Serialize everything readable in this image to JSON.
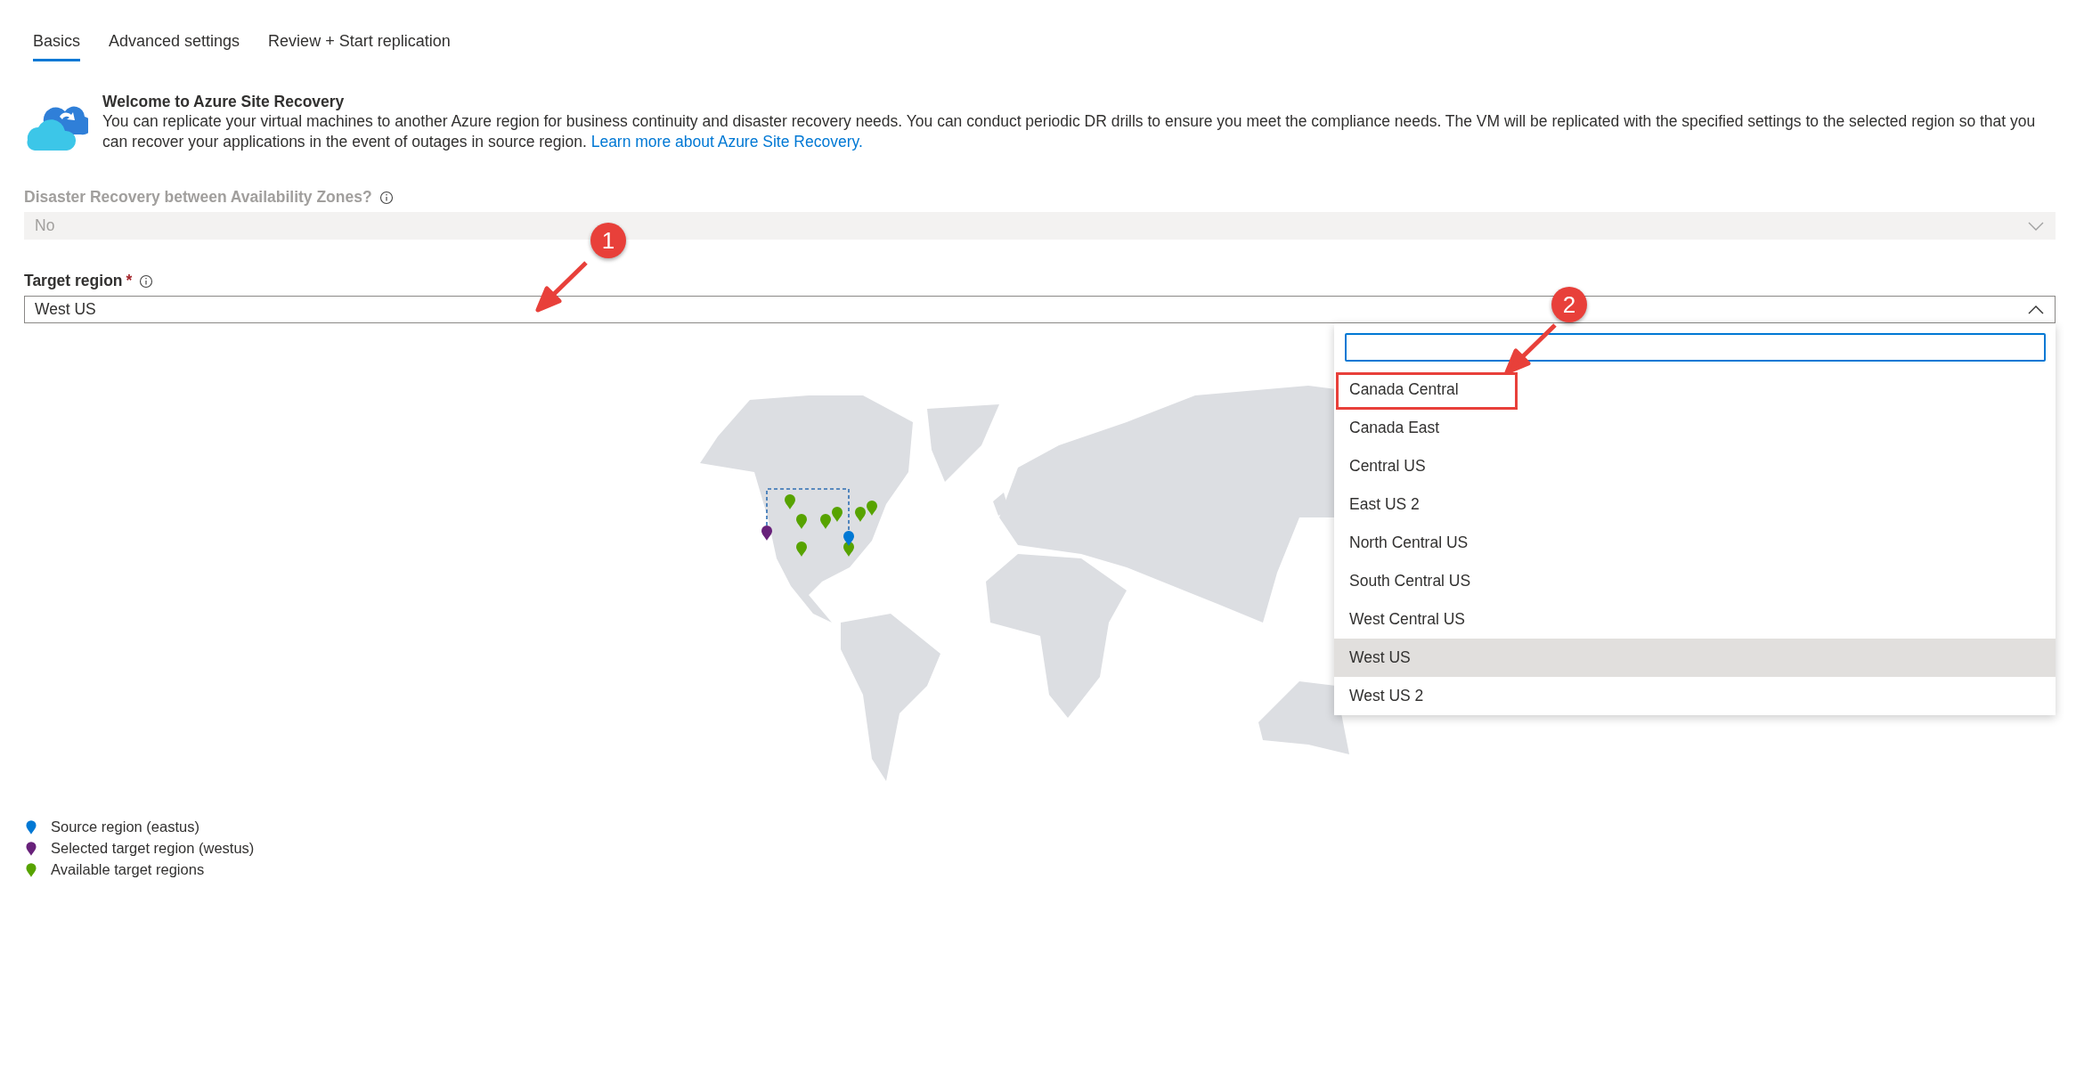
{
  "tabs": [
    {
      "label": "Basics",
      "selected": true
    },
    {
      "label": "Advanced settings",
      "selected": false
    },
    {
      "label": "Review + Start replication",
      "selected": false
    }
  ],
  "intro": {
    "title": "Welcome to Azure Site Recovery",
    "text": "You can replicate your virtual machines to another Azure region for business continuity and disaster recovery needs. You can conduct periodic DR drills to ensure you meet the compliance needs. The VM will be replicated with the specified settings to the selected region so that you can recover your applications in the event of outages in source region.",
    "link": "Learn more about Azure Site Recovery."
  },
  "zone_field": {
    "label": "Disaster Recovery between Availability Zones?",
    "value": "No",
    "disabled": true
  },
  "region_field": {
    "label": "Target region",
    "required_mark": "*",
    "value": "West US",
    "expanded": true,
    "options": [
      {
        "label": "Canada Central",
        "selected": false,
        "highlighted": true
      },
      {
        "label": "Canada East",
        "selected": false,
        "highlighted": false
      },
      {
        "label": "Central US",
        "selected": false,
        "highlighted": false
      },
      {
        "label": "East US 2",
        "selected": false,
        "highlighted": false
      },
      {
        "label": "North Central US",
        "selected": false,
        "highlighted": false
      },
      {
        "label": "South Central US",
        "selected": false,
        "highlighted": false
      },
      {
        "label": "West Central US",
        "selected": false,
        "highlighted": false
      },
      {
        "label": "West US",
        "selected": true,
        "highlighted": false
      },
      {
        "label": "West US 2",
        "selected": false,
        "highlighted": false
      }
    ]
  },
  "callouts": [
    {
      "label": "1"
    },
    {
      "label": "2"
    }
  ],
  "legend": [
    {
      "label": "Source region (eastus)",
      "color": "#0078d4"
    },
    {
      "label": "Selected target region (westus)",
      "color": "#68217a"
    },
    {
      "label": "Available target regions",
      "color": "#57a300"
    }
  ]
}
